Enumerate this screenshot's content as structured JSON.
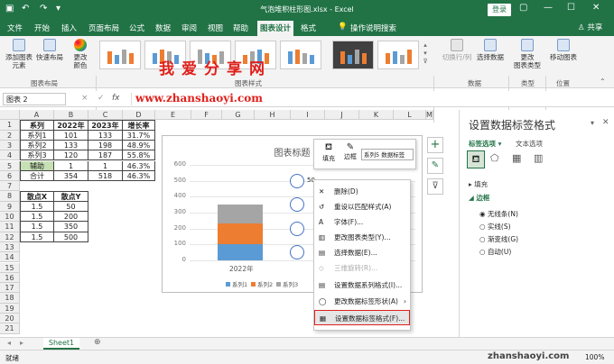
{
  "window": {
    "title": "气泡堆积柱形图.xlsx - Excel",
    "login": "登录"
  },
  "tabs": [
    "文件",
    "开始",
    "插入",
    "页面布局",
    "公式",
    "数据",
    "审阅",
    "视图",
    "帮助",
    "图表设计",
    "格式"
  ],
  "active_tab": "图表设计",
  "tell_me": "操作说明搜索",
  "share": "共享",
  "ribbon": {
    "add_element": "添加图表\n元素",
    "quick_layout": "快速布局",
    "change_colors": "更改\n颜色",
    "group_layout": "图表布局",
    "group_styles": "图表样式",
    "switch_row_col": "切换行/列",
    "select_data": "选择数据",
    "change_type": "更改\n图表类型",
    "move_chart": "移动图表",
    "group_data": "数据",
    "group_type": "类型",
    "group_location": "位置"
  },
  "watermark": "我爱分享网",
  "url_watermark": "www.zhanshaoyi.com",
  "name_box": "图表 2",
  "formula_symbols": [
    "×",
    "✓",
    "fx"
  ],
  "columns": [
    "A",
    "B",
    "C",
    "D",
    "E",
    "F",
    "G",
    "H",
    "I",
    "J",
    "K",
    "L",
    "M"
  ],
  "rows": [
    "1",
    "2",
    "3",
    "4",
    "5",
    "6",
    "7",
    "8",
    "9",
    "10",
    "11",
    "12",
    "13",
    "14",
    "15",
    "16",
    "17",
    "18",
    "19",
    "20",
    "21"
  ],
  "table1": [
    [
      "系列",
      "2022年",
      "2023年",
      "增长率"
    ],
    [
      "系列1",
      "101",
      "133",
      "31.7%"
    ],
    [
      "系列2",
      "133",
      "198",
      "48.9%"
    ],
    [
      "系列3",
      "120",
      "187",
      "55.8%"
    ],
    [
      "辅助",
      "1",
      "1",
      "46.3%"
    ],
    [
      "合计",
      "354",
      "518",
      "46.3%"
    ]
  ],
  "table2": [
    [
      "散点X",
      "散点Y"
    ],
    [
      "1.5",
      "50"
    ],
    [
      "1.5",
      "200"
    ],
    [
      "1.5",
      "350"
    ],
    [
      "1.5",
      "500"
    ]
  ],
  "chart_data": {
    "type": "bar",
    "title": "图表标题",
    "categories": [
      "2022年"
    ],
    "series": [
      {
        "name": "系列1",
        "values": [
          101
        ]
      },
      {
        "name": "系列2",
        "values": [
          133
        ]
      },
      {
        "name": "系列3",
        "values": [
          120
        ]
      },
      {
        "name": "辅助",
        "values": [
          1
        ]
      }
    ],
    "ylim": [
      0,
      600
    ],
    "yticks": [
      "0",
      "100",
      "200",
      "300",
      "400",
      "500",
      "600"
    ],
    "legend_visible": [
      "系列1",
      "系列2",
      "系列3"
    ],
    "legend_position": "bottom",
    "label_partial": "50",
    "colors": {
      "系列1": "#5b9bd5",
      "系列2": "#ed7d31",
      "系列3": "#a5a5a5"
    }
  },
  "mini_toolbar": {
    "fill": "填充",
    "outline": "边框",
    "selector": "系列5 数据标签"
  },
  "context_menu": [
    {
      "label": "删除(D)",
      "enabled": true
    },
    {
      "label": "重设以匹配样式(A)",
      "enabled": true
    },
    {
      "label": "字体(F)...",
      "enabled": true
    },
    {
      "label": "更改图表类型(Y)...",
      "enabled": true
    },
    {
      "label": "选择数据(E)...",
      "enabled": true
    },
    {
      "label": "三维旋转(R)...",
      "enabled": false
    },
    {
      "label": "设置数据系列格式(I)...",
      "enabled": true
    },
    {
      "label": "更改数据标签形状(A)",
      "enabled": true
    },
    {
      "label": "设置数据标签格式(F)...",
      "enabled": true
    }
  ],
  "pane": {
    "title": "设置数据标签格式",
    "tab1": "标签选项",
    "tab2": "文本选项",
    "fill": "填充",
    "border": "边框",
    "opt1": "无线条(N)",
    "opt2": "实线(S)",
    "opt3": "渐变线(G)",
    "opt4": "自动(U)"
  },
  "sheet_tab": "Sheet1",
  "status": {
    "ready": "就绪",
    "zoom": "100%",
    "site": "zhanshaoyi.com"
  }
}
